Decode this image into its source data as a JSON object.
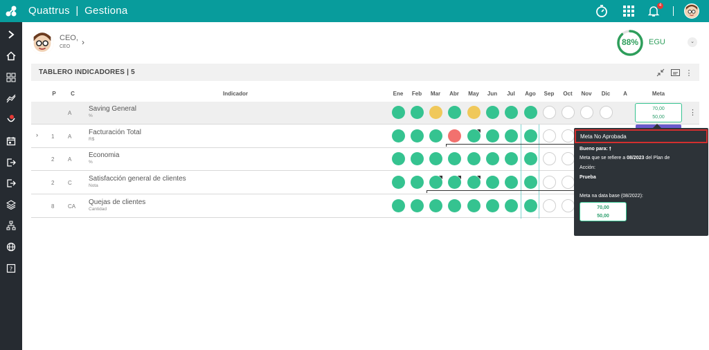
{
  "app": {
    "brand": "Quattrus",
    "module": "Gestiona",
    "separator": "|",
    "notification_count": "4"
  },
  "user": {
    "name": "CEO,",
    "role": "CEO"
  },
  "score": {
    "percent": "88%",
    "label": "EGU",
    "value": 0.88,
    "color": "#2e9e5b"
  },
  "panel": {
    "title": "TABLERO INDICADORES | 5"
  },
  "columns": {
    "p": "P",
    "c": "C",
    "indicator": "Indicador",
    "months": [
      "Ene",
      "Feb",
      "Mar",
      "Abr",
      "May",
      "Jun",
      "Jul",
      "Ago",
      "Sep",
      "Oct",
      "Nov",
      "Dic"
    ],
    "a": "A",
    "meta": "Meta"
  },
  "rows": [
    {
      "p": "",
      "c": "A",
      "name": "Saving General",
      "unit": "%",
      "statuses": [
        "green",
        "green",
        "yellow",
        "green",
        "yellow",
        "green",
        "green",
        "green",
        "empty",
        "empty",
        "empty",
        "empty"
      ],
      "meta_top": "70,00",
      "meta_bottom": "50,00"
    },
    {
      "p": "1",
      "c": "A",
      "name": "Facturación Total",
      "unit": "R$",
      "statuses": [
        "green",
        "green",
        "green",
        "red",
        "green",
        "green",
        "green",
        "green",
        "empty",
        "empty",
        "empty",
        "empty"
      ]
    },
    {
      "p": "2",
      "c": "A",
      "name": "Economia",
      "unit": "%",
      "statuses": [
        "green",
        "green",
        "green",
        "green",
        "green",
        "green",
        "green",
        "green",
        "empty",
        "empty",
        "empty",
        "empty"
      ]
    },
    {
      "p": "2",
      "c": "C",
      "name": "Satisfacción general de clientes",
      "unit": "Nota",
      "statuses": [
        "green",
        "green",
        "green",
        "green",
        "green",
        "green",
        "green",
        "green",
        "empty",
        "empty",
        "empty",
        "empty"
      ]
    },
    {
      "p": "8",
      "c": "CA",
      "name": "Quejas de clientes",
      "unit": "Cantidad",
      "statuses": [
        "green",
        "green",
        "green",
        "green",
        "green",
        "green",
        "green",
        "green",
        "empty",
        "empty",
        "empty",
        "empty"
      ]
    }
  ],
  "tooltip": {
    "header": "Meta No Aprobada",
    "good_for": "Bueno para:",
    "good_for_arrow": "🠕",
    "refers_prefix": "Meta que se refiere a",
    "refers_period": "08/2023",
    "refers_suffix": "del Plan de",
    "refers_line2": "Acción:",
    "plan": "Prueba",
    "db_label": "Meta na data base (08/2022):",
    "db_top": "70,00",
    "db_bottom": "50,00"
  },
  "colors": {
    "accent": "#089c9c",
    "green": "#35c390",
    "yellow": "#f0c85a",
    "red": "#f2716e",
    "sidebar": "#262b31"
  }
}
